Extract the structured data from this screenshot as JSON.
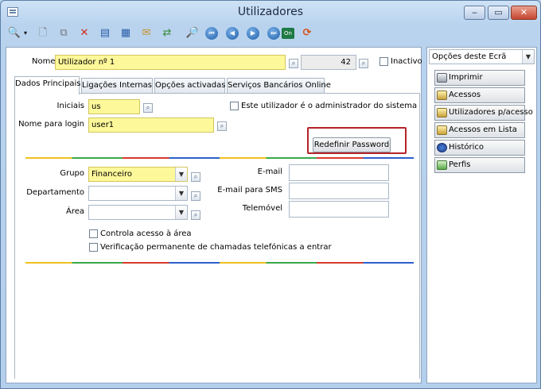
{
  "window": {
    "title": "Utilizadores"
  },
  "header": {
    "name_label": "Nome",
    "name_value": "Utilizador nº 1",
    "id_value": "42",
    "inactive_label": "Inactivo"
  },
  "tabs": [
    {
      "label": "Dados Principais"
    },
    {
      "label": "Ligações Internas"
    },
    {
      "label": "Opções activadas"
    },
    {
      "label": "Serviços Bancários Online"
    }
  ],
  "form": {
    "initials_label": "Iniciais",
    "initials_value": "us",
    "admin_label": "Este utilizador é o administrador do sistema",
    "login_label": "Nome para login",
    "login_value": "user1",
    "reset_password_label": "Redefinir Password",
    "group_label": "Grupo",
    "group_value": "Financeiro",
    "department_label": "Departamento",
    "area_label": "Área",
    "email_label": "E-mail",
    "sms_email_label": "E-mail para SMS",
    "mobile_label": "Telemóvel",
    "area_access_label": "Controla acesso à área",
    "call_check_label": "Verificação permanente de chamadas telefónicas a entrar"
  },
  "side": {
    "options_label": "Opções deste Ecrã",
    "buttons": [
      {
        "label": "Imprimir"
      },
      {
        "label": "Acessos"
      },
      {
        "label": "Utilizadores p/acesso"
      },
      {
        "label": "Acessos em Lista"
      },
      {
        "label": "Histórico"
      },
      {
        "label": "Perfis"
      }
    ]
  },
  "toolbar": {
    "on_label": "On"
  },
  "icons": {
    "app": "window-icon",
    "search": "search-icon",
    "new": "new-document-icon",
    "copy": "copy-icon",
    "delete": "delete-icon",
    "edit": "edit-icon",
    "grid": "table-icon",
    "mail": "mail-icon",
    "refresh": "refresh-icon",
    "preview": "preview-icon",
    "first": "first-record-icon",
    "prev": "previous-record-icon",
    "next": "next-record-icon",
    "last": "last-record-icon",
    "on": "on-icon",
    "help": "help-icon"
  }
}
